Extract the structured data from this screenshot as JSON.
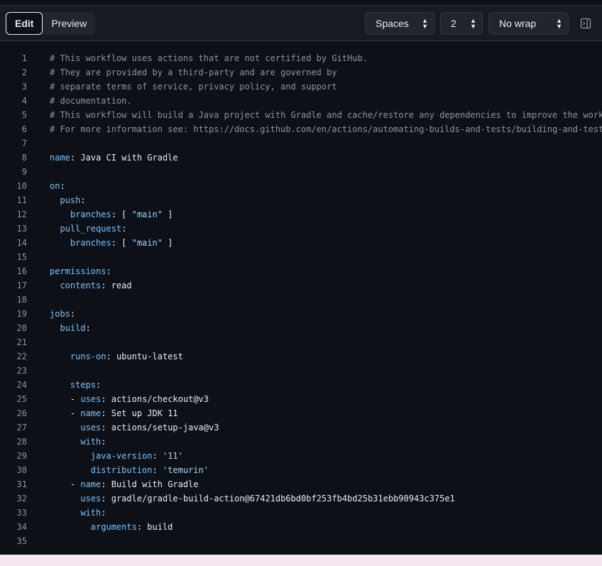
{
  "toolbar": {
    "tabs": [
      {
        "label": "Edit",
        "active": true
      },
      {
        "label": "Preview",
        "active": false
      }
    ],
    "indent_mode": "Spaces",
    "indent_size": "2",
    "wrap_mode": "No wrap",
    "panel_icon": "sidebar-toggle-icon"
  },
  "editor": {
    "lines": [
      {
        "n": "1",
        "k": "",
        "sep": "",
        "v": "",
        "c": "# This workflow uses actions that are not certified by GitHub."
      },
      {
        "n": "2",
        "k": "",
        "sep": "",
        "v": "",
        "c": "# They are provided by a third-party and are governed by"
      },
      {
        "n": "3",
        "k": "",
        "sep": "",
        "v": "",
        "c": "# separate terms of service, privacy policy, and support"
      },
      {
        "n": "4",
        "k": "",
        "sep": "",
        "v": "",
        "c": "# documentation."
      },
      {
        "n": "5",
        "k": "",
        "sep": "",
        "v": "",
        "c": "# This workflow will build a Java project with Gradle and cache/restore any dependencies to improve the workflow execution time"
      },
      {
        "n": "6",
        "k": "",
        "sep": "",
        "v": "",
        "c": "# For more information see: https://docs.github.com/en/actions/automating-builds-and-tests/building-and-testing-java-with-gradle"
      },
      {
        "n": "7",
        "k": "",
        "sep": "",
        "v": "",
        "c": ""
      },
      {
        "n": "8",
        "k": "name",
        "sep": ": ",
        "v": "Java CI with Gradle",
        "c": ""
      },
      {
        "n": "9",
        "k": "",
        "sep": "",
        "v": "",
        "c": ""
      },
      {
        "n": "10",
        "k": "on",
        "sep": ":",
        "v": "",
        "c": ""
      },
      {
        "n": "11",
        "k": "  push",
        "sep": ":",
        "v": "",
        "c": ""
      },
      {
        "n": "12",
        "k": "    branches",
        "sep": ": [ ",
        "v": "\"main\"",
        "c": " ]"
      },
      {
        "n": "13",
        "k": "  pull_request",
        "sep": ":",
        "v": "",
        "c": ""
      },
      {
        "n": "14",
        "k": "    branches",
        "sep": ": [ ",
        "v": "\"main\"",
        "c": " ]"
      },
      {
        "n": "15",
        "k": "",
        "sep": "",
        "v": "",
        "c": ""
      },
      {
        "n": "16",
        "k": "permissions",
        "sep": ":",
        "v": "",
        "c": ""
      },
      {
        "n": "17",
        "k": "  contents",
        "sep": ": ",
        "v": "read",
        "c": ""
      },
      {
        "n": "18",
        "k": "",
        "sep": "",
        "v": "",
        "c": ""
      },
      {
        "n": "19",
        "k": "jobs",
        "sep": ":",
        "v": "",
        "c": ""
      },
      {
        "n": "20",
        "k": "  build",
        "sep": ":",
        "v": "",
        "c": ""
      },
      {
        "n": "21",
        "k": "",
        "sep": "",
        "v": "",
        "c": ""
      },
      {
        "n": "22",
        "k": "    runs-on",
        "sep": ": ",
        "v": "ubuntu-latest",
        "c": ""
      },
      {
        "n": "23",
        "k": "",
        "sep": "",
        "v": "",
        "c": ""
      },
      {
        "n": "24",
        "k": "    steps",
        "sep": ":",
        "v": "",
        "c": ""
      },
      {
        "n": "25",
        "k": "    - uses",
        "sep": ": ",
        "v": "actions/checkout@v3",
        "c": ""
      },
      {
        "n": "26",
        "k": "    - name",
        "sep": ": ",
        "v": "Set up JDK 11",
        "c": ""
      },
      {
        "n": "27",
        "k": "      uses",
        "sep": ": ",
        "v": "actions/setup-java@v3",
        "c": ""
      },
      {
        "n": "28",
        "k": "      with",
        "sep": ":",
        "v": "",
        "c": ""
      },
      {
        "n": "29",
        "k": "        java-version",
        "sep": ": ",
        "v": "'11'",
        "c": ""
      },
      {
        "n": "30",
        "k": "        distribution",
        "sep": ": ",
        "v": "'temurin'",
        "c": ""
      },
      {
        "n": "31",
        "k": "    - name",
        "sep": ": ",
        "v": "Build with Gradle",
        "c": ""
      },
      {
        "n": "32",
        "k": "      uses",
        "sep": ": ",
        "v": "gradle/gradle-build-action@67421db6bd0bf253fb4bd25b31ebb98943c375e1",
        "c": ""
      },
      {
        "n": "33",
        "k": "      with",
        "sep": ":",
        "v": "",
        "c": ""
      },
      {
        "n": "34",
        "k": "        arguments",
        "sep": ": ",
        "v": "build",
        "c": ""
      },
      {
        "n": "35",
        "k": "",
        "sep": "",
        "v": "",
        "c": ""
      }
    ]
  },
  "colors": {
    "background": "#0d1117",
    "toolbar": "#161b22",
    "comment": "#8b949e",
    "key": "#79c0ff",
    "string": "#a5d6ff",
    "text": "#e6edf3"
  }
}
